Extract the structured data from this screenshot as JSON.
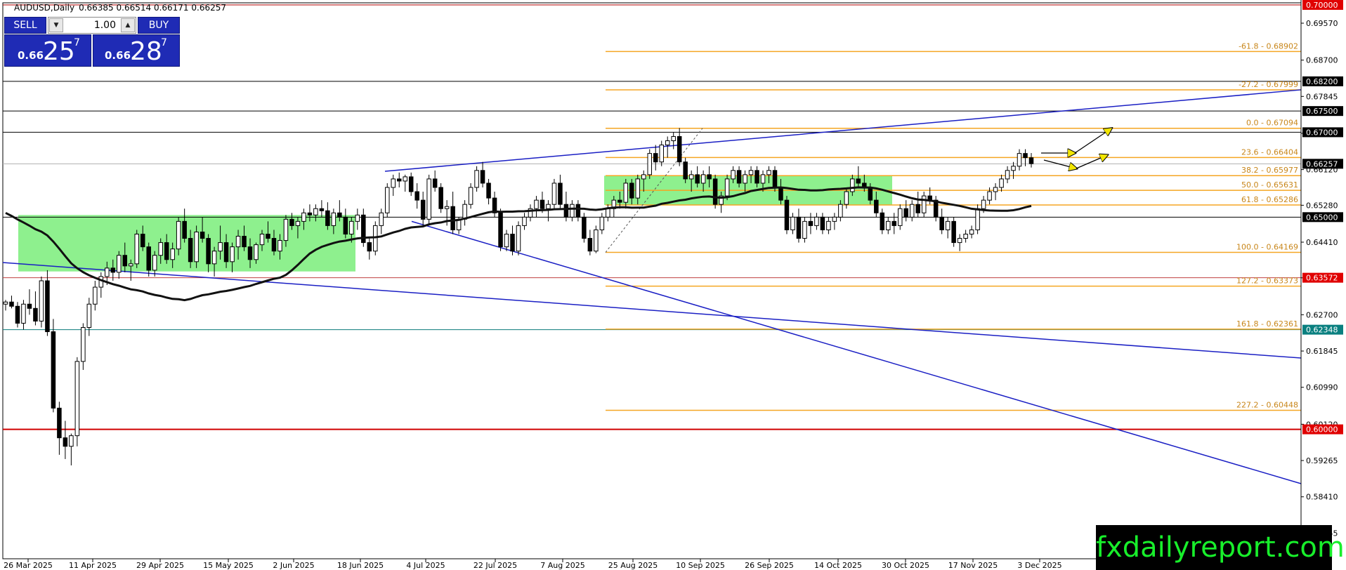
{
  "header": {
    "symbol": "AUDUSD,Daily",
    "ohlc": "0.66385 0.66514 0.66171 0.66257"
  },
  "trade_panel": {
    "sell_label": "SELL",
    "buy_label": "BUY",
    "quantity": "1.00",
    "sell_prefix": "0.66",
    "sell_big": "25",
    "sell_sup": "7",
    "buy_prefix": "0.66",
    "buy_big": "28",
    "buy_sup": "7"
  },
  "brand": {
    "text": "fxdailyreport.com"
  },
  "colors": {
    "fib": "#f5a623",
    "trend": "#1a1fc4",
    "ma": "#111111",
    "zone": "#8ef08e",
    "red_level": "#d00000",
    "teal_level": "#0a7a7a",
    "arrow": "#f2e600"
  },
  "chart_data": {
    "type": "candlestick",
    "symbol": "AUDUSD",
    "timeframe": "Daily",
    "ylim": [
      0.5695,
      0.7005
    ],
    "y_ticks": [
      "0.69570",
      "0.68700",
      "0.67845",
      "0.66975",
      "0.66120",
      "0.65280",
      "0.64410",
      "0.63570",
      "0.62700",
      "0.61845",
      "0.60990",
      "0.60120",
      "0.59265",
      "0.58410",
      "0.57555"
    ],
    "x_ticks": [
      "26 Mar 2025",
      "11 Apr 2025",
      "29 Apr 2025",
      "15 May 2025",
      "2 Jun 2025",
      "18 Jun 2025",
      "4 Jul 2025",
      "22 Jul 2025",
      "7 Aug 2025",
      "25 Aug 2025",
      "10 Sep 2025",
      "26 Sep 2025",
      "14 Oct 2025",
      "30 Oct 2025",
      "17 Nov 2025",
      "3 Dec 2025"
    ],
    "current_price": "0.66257",
    "level_tags": [
      {
        "value": "0.70000",
        "price": 0.7,
        "style": "red"
      },
      {
        "value": "0.68200",
        "price": 0.682,
        "style": "black"
      },
      {
        "value": "0.67500",
        "price": 0.675,
        "style": "black"
      },
      {
        "value": "0.67000",
        "price": 0.67,
        "style": "black"
      },
      {
        "value": "0.66257",
        "price": 0.66257,
        "style": "black"
      },
      {
        "value": "0.65000",
        "price": 0.65,
        "style": "black"
      },
      {
        "value": "0.63572",
        "price": 0.63572,
        "style": "red"
      },
      {
        "value": "0.62348",
        "price": 0.62348,
        "style": "teal"
      },
      {
        "value": "0.60000",
        "price": 0.6,
        "style": "red"
      }
    ],
    "fib_levels": [
      {
        "label": "-61.8 - 0.68902",
        "price": 0.68902
      },
      {
        "label": "-27.2 - 0.67999",
        "price": 0.67999
      },
      {
        "label": "0.0 - 0.67094",
        "price": 0.67094
      },
      {
        "label": "23.6 - 0.66404",
        "price": 0.66404
      },
      {
        "label": "38.2 - 0.65977",
        "price": 0.65977
      },
      {
        "label": "50.0 - 0.65631",
        "price": 0.65631
      },
      {
        "label": "61.8 - 0.65286",
        "price": 0.65286
      },
      {
        "label": "100.0 - 0.64169",
        "price": 0.64169
      },
      {
        "label": "127.2 - 0.63373",
        "price": 0.63373
      },
      {
        "label": "161.8 - 0.62361",
        "price": 0.62361
      },
      {
        "label": "227.2 - 0.60448",
        "price": 0.60448
      }
    ],
    "candles": [
      [
        0.6295,
        0.6305,
        0.628,
        0.63
      ],
      [
        0.63,
        0.6315,
        0.6285,
        0.629
      ],
      [
        0.629,
        0.63,
        0.624,
        0.625
      ],
      [
        0.625,
        0.6305,
        0.6235,
        0.6295
      ],
      [
        0.6295,
        0.633,
        0.627,
        0.6285
      ],
      [
        0.6285,
        0.6325,
        0.6245,
        0.6255
      ],
      [
        0.6255,
        0.636,
        0.624,
        0.635
      ],
      [
        0.635,
        0.6375,
        0.622,
        0.623
      ],
      [
        0.623,
        0.626,
        0.604,
        0.605
      ],
      [
        0.605,
        0.6065,
        0.594,
        0.598
      ],
      [
        0.598,
        0.602,
        0.593,
        0.596
      ],
      [
        0.596,
        0.599,
        0.5915,
        0.5985
      ],
      [
        0.5985,
        0.617,
        0.596,
        0.616
      ],
      [
        0.616,
        0.625,
        0.614,
        0.624
      ],
      [
        0.624,
        0.631,
        0.622,
        0.6295
      ],
      [
        0.6295,
        0.635,
        0.628,
        0.6335
      ],
      [
        0.6335,
        0.637,
        0.631,
        0.636
      ],
      [
        0.636,
        0.6395,
        0.634,
        0.638
      ],
      [
        0.638,
        0.64,
        0.635,
        0.637
      ],
      [
        0.637,
        0.642,
        0.6355,
        0.641
      ],
      [
        0.641,
        0.644,
        0.637,
        0.6385
      ],
      [
        0.6385,
        0.64,
        0.635,
        0.639
      ],
      [
        0.639,
        0.647,
        0.638,
        0.646
      ],
      [
        0.646,
        0.648,
        0.642,
        0.643
      ],
      [
        0.643,
        0.644,
        0.636,
        0.6375
      ],
      [
        0.6375,
        0.642,
        0.636,
        0.641
      ],
      [
        0.641,
        0.645,
        0.639,
        0.644
      ],
      [
        0.644,
        0.646,
        0.639,
        0.64
      ],
      [
        0.64,
        0.644,
        0.638,
        0.6425
      ],
      [
        0.6425,
        0.65,
        0.641,
        0.649
      ],
      [
        0.649,
        0.652,
        0.644,
        0.645
      ],
      [
        0.645,
        0.647,
        0.638,
        0.6395
      ],
      [
        0.6395,
        0.648,
        0.638,
        0.6465
      ],
      [
        0.6465,
        0.65,
        0.644,
        0.645
      ],
      [
        0.645,
        0.646,
        0.637,
        0.639
      ],
      [
        0.639,
        0.643,
        0.636,
        0.642
      ],
      [
        0.642,
        0.648,
        0.64,
        0.644
      ],
      [
        0.644,
        0.646,
        0.638,
        0.6395
      ],
      [
        0.6395,
        0.644,
        0.637,
        0.643
      ],
      [
        0.643,
        0.647,
        0.64,
        0.6455
      ],
      [
        0.6455,
        0.648,
        0.642,
        0.643
      ],
      [
        0.643,
        0.645,
        0.638,
        0.64
      ],
      [
        0.64,
        0.644,
        0.639,
        0.6435
      ],
      [
        0.6435,
        0.647,
        0.642,
        0.646
      ],
      [
        0.646,
        0.649,
        0.644,
        0.645
      ],
      [
        0.645,
        0.647,
        0.641,
        0.642
      ],
      [
        0.642,
        0.646,
        0.64,
        0.6445
      ],
      [
        0.6445,
        0.6505,
        0.643,
        0.6495
      ],
      [
        0.6495,
        0.651,
        0.647,
        0.648
      ],
      [
        0.648,
        0.65,
        0.645,
        0.649
      ],
      [
        0.649,
        0.652,
        0.647,
        0.651
      ],
      [
        0.651,
        0.653,
        0.649,
        0.6505
      ],
      [
        0.6505,
        0.653,
        0.649,
        0.652
      ],
      [
        0.652,
        0.654,
        0.65,
        0.6515
      ],
      [
        0.6515,
        0.6535,
        0.647,
        0.648
      ],
      [
        0.648,
        0.652,
        0.646,
        0.651
      ],
      [
        0.651,
        0.654,
        0.649,
        0.65
      ],
      [
        0.65,
        0.652,
        0.645,
        0.646
      ],
      [
        0.646,
        0.65,
        0.644,
        0.649
      ],
      [
        0.649,
        0.652,
        0.647,
        0.6505
      ],
      [
        0.6505,
        0.652,
        0.643,
        0.644
      ],
      [
        0.644,
        0.645,
        0.64,
        0.642
      ],
      [
        0.642,
        0.649,
        0.641,
        0.648
      ],
      [
        0.648,
        0.652,
        0.646,
        0.651
      ],
      [
        0.651,
        0.658,
        0.65,
        0.657
      ],
      [
        0.657,
        0.66,
        0.655,
        0.659
      ],
      [
        0.659,
        0.6605,
        0.657,
        0.6585
      ],
      [
        0.6585,
        0.66,
        0.656,
        0.6595
      ],
      [
        0.6595,
        0.6605,
        0.655,
        0.656
      ],
      [
        0.656,
        0.658,
        0.652,
        0.654
      ],
      [
        0.654,
        0.656,
        0.648,
        0.6495
      ],
      [
        0.6495,
        0.66,
        0.648,
        0.659
      ],
      [
        0.659,
        0.661,
        0.656,
        0.657
      ],
      [
        0.657,
        0.658,
        0.651,
        0.652
      ],
      [
        0.652,
        0.654,
        0.648,
        0.6525
      ],
      [
        0.6525,
        0.656,
        0.646,
        0.647
      ],
      [
        0.647,
        0.65,
        0.646,
        0.6495
      ],
      [
        0.6495,
        0.654,
        0.648,
        0.653
      ],
      [
        0.653,
        0.658,
        0.652,
        0.657
      ],
      [
        0.657,
        0.662,
        0.656,
        0.661
      ],
      [
        0.661,
        0.663,
        0.657,
        0.658
      ],
      [
        0.658,
        0.659,
        0.653,
        0.6545
      ],
      [
        0.6545,
        0.656,
        0.65,
        0.651
      ],
      [
        0.651,
        0.652,
        0.642,
        0.643
      ],
      [
        0.643,
        0.647,
        0.642,
        0.646
      ],
      [
        0.646,
        0.648,
        0.641,
        0.642
      ],
      [
        0.642,
        0.649,
        0.641,
        0.648
      ],
      [
        0.648,
        0.651,
        0.647,
        0.65
      ],
      [
        0.65,
        0.653,
        0.649,
        0.652
      ],
      [
        0.652,
        0.655,
        0.65,
        0.654
      ],
      [
        0.654,
        0.656,
        0.651,
        0.652
      ],
      [
        0.652,
        0.654,
        0.649,
        0.653
      ],
      [
        0.653,
        0.659,
        0.652,
        0.658
      ],
      [
        0.658,
        0.66,
        0.652,
        0.653
      ],
      [
        0.653,
        0.656,
        0.649,
        0.65
      ],
      [
        0.65,
        0.654,
        0.649,
        0.653
      ],
      [
        0.653,
        0.654,
        0.649,
        0.65
      ],
      [
        0.65,
        0.651,
        0.644,
        0.645
      ],
      [
        0.645,
        0.647,
        0.641,
        0.642
      ],
      [
        0.642,
        0.648,
        0.6415,
        0.647
      ],
      [
        0.647,
        0.651,
        0.646,
        0.65
      ],
      [
        0.65,
        0.653,
        0.649,
        0.652
      ],
      [
        0.652,
        0.655,
        0.65,
        0.654
      ],
      [
        0.654,
        0.656,
        0.652,
        0.6535
      ],
      [
        0.6535,
        0.659,
        0.652,
        0.658
      ],
      [
        0.658,
        0.659,
        0.653,
        0.6545
      ],
      [
        0.6545,
        0.66,
        0.653,
        0.659
      ],
      [
        0.659,
        0.661,
        0.656,
        0.66
      ],
      [
        0.66,
        0.666,
        0.659,
        0.665
      ],
      [
        0.665,
        0.667,
        0.661,
        0.663
      ],
      [
        0.663,
        0.668,
        0.662,
        0.667
      ],
      [
        0.667,
        0.669,
        0.664,
        0.668
      ],
      [
        0.668,
        0.67,
        0.666,
        0.669
      ],
      [
        0.669,
        0.671,
        0.662,
        0.663
      ],
      [
        0.663,
        0.664,
        0.658,
        0.659
      ],
      [
        0.659,
        0.661,
        0.656,
        0.66
      ],
      [
        0.66,
        0.662,
        0.657,
        0.658
      ],
      [
        0.658,
        0.661,
        0.656,
        0.66
      ],
      [
        0.66,
        0.662,
        0.657,
        0.659
      ],
      [
        0.659,
        0.66,
        0.652,
        0.653
      ],
      [
        0.653,
        0.656,
        0.651,
        0.655
      ],
      [
        0.655,
        0.66,
        0.654,
        0.659
      ],
      [
        0.659,
        0.662,
        0.658,
        0.661
      ],
      [
        0.661,
        0.662,
        0.657,
        0.658
      ],
      [
        0.658,
        0.661,
        0.656,
        0.66
      ],
      [
        0.66,
        0.662,
        0.658,
        0.661
      ],
      [
        0.661,
        0.662,
        0.657,
        0.658
      ],
      [
        0.658,
        0.661,
        0.656,
        0.66
      ],
      [
        0.66,
        0.662,
        0.658,
        0.661
      ],
      [
        0.661,
        0.662,
        0.656,
        0.657
      ],
      [
        0.657,
        0.659,
        0.653,
        0.654
      ],
      [
        0.654,
        0.655,
        0.646,
        0.647
      ],
      [
        0.647,
        0.651,
        0.646,
        0.65
      ],
      [
        0.65,
        0.652,
        0.644,
        0.645
      ],
      [
        0.645,
        0.65,
        0.644,
        0.649
      ],
      [
        0.649,
        0.651,
        0.646,
        0.648
      ],
      [
        0.648,
        0.651,
        0.647,
        0.65
      ],
      [
        0.65,
        0.651,
        0.646,
        0.647
      ],
      [
        0.647,
        0.65,
        0.646,
        0.649
      ],
      [
        0.649,
        0.651,
        0.647,
        0.65
      ],
      [
        0.65,
        0.654,
        0.649,
        0.653
      ],
      [
        0.653,
        0.657,
        0.652,
        0.656
      ],
      [
        0.656,
        0.66,
        0.655,
        0.659
      ],
      [
        0.659,
        0.662,
        0.657,
        0.658
      ],
      [
        0.658,
        0.66,
        0.656,
        0.657
      ],
      [
        0.657,
        0.658,
        0.653,
        0.654
      ],
      [
        0.654,
        0.656,
        0.65,
        0.651
      ],
      [
        0.651,
        0.652,
        0.646,
        0.647
      ],
      [
        0.647,
        0.65,
        0.646,
        0.649
      ],
      [
        0.649,
        0.651,
        0.646,
        0.648
      ],
      [
        0.648,
        0.653,
        0.647,
        0.652
      ],
      [
        0.652,
        0.654,
        0.649,
        0.65
      ],
      [
        0.65,
        0.654,
        0.649,
        0.653
      ],
      [
        0.653,
        0.656,
        0.65,
        0.651
      ],
      [
        0.651,
        0.656,
        0.65,
        0.655
      ],
      [
        0.655,
        0.657,
        0.653,
        0.654
      ],
      [
        0.654,
        0.655,
        0.649,
        0.65
      ],
      [
        0.65,
        0.652,
        0.646,
        0.647
      ],
      [
        0.647,
        0.65,
        0.645,
        0.649
      ],
      [
        0.649,
        0.65,
        0.643,
        0.644
      ],
      [
        0.644,
        0.646,
        0.642,
        0.645
      ],
      [
        0.645,
        0.647,
        0.644,
        0.646
      ],
      [
        0.646,
        0.648,
        0.645,
        0.647
      ],
      [
        0.647,
        0.653,
        0.646,
        0.652
      ],
      [
        0.652,
        0.655,
        0.651,
        0.654
      ],
      [
        0.654,
        0.657,
        0.653,
        0.656
      ],
      [
        0.656,
        0.658,
        0.654,
        0.657
      ],
      [
        0.657,
        0.66,
        0.656,
        0.659
      ],
      [
        0.659,
        0.662,
        0.658,
        0.661
      ],
      [
        0.661,
        0.663,
        0.659,
        0.662
      ],
      [
        0.662,
        0.666,
        0.661,
        0.665
      ],
      [
        0.665,
        0.666,
        0.662,
        0.664
      ],
      [
        0.664,
        0.6651,
        0.6617,
        0.6626
      ]
    ]
  }
}
